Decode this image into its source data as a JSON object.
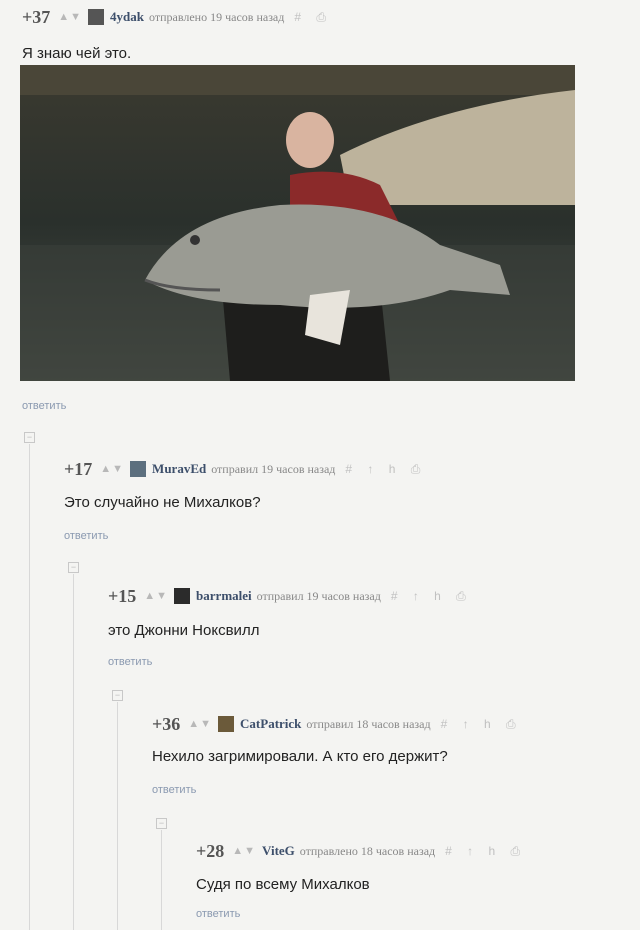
{
  "comments": [
    {
      "rating": "+37",
      "user": "4ydak",
      "time": "отправлено 19 часов назад",
      "text": "Я знаю чей это.",
      "reply": "ответить",
      "icons": "# ⎙"
    },
    {
      "rating": "+17",
      "user": "MuravEd",
      "time": "отправил 19 часов назад",
      "text": "Это случайно не Михалков?",
      "reply": "ответить",
      "icons": "# ↑ h ⎙"
    },
    {
      "rating": "+15",
      "user": "barrmalei",
      "time": "отправил 19 часов назад",
      "text": "это Джонни Ноксвилл",
      "reply": "ответить",
      "icons": "# ↑ h ⎙"
    },
    {
      "rating": "+36",
      "user": "CatPatrick",
      "time": "отправил 18 часов назад",
      "text": "Нехило загримировали. А кто его держит?",
      "reply": "ответить",
      "icons": "# ↑ h ⎙"
    },
    {
      "rating": "+28",
      "user": "ViteG",
      "time": "отправлено 18 часов назад",
      "text": "Судя по всему Михалков",
      "reply": "ответить",
      "icons": "# ↑ h ⎙"
    }
  ],
  "vote_arrows": "▲▼",
  "collapse_symbol": "−",
  "colors": {
    "username": "#3d4f6b",
    "reply": "#8a99b0",
    "rating": "#555555"
  }
}
